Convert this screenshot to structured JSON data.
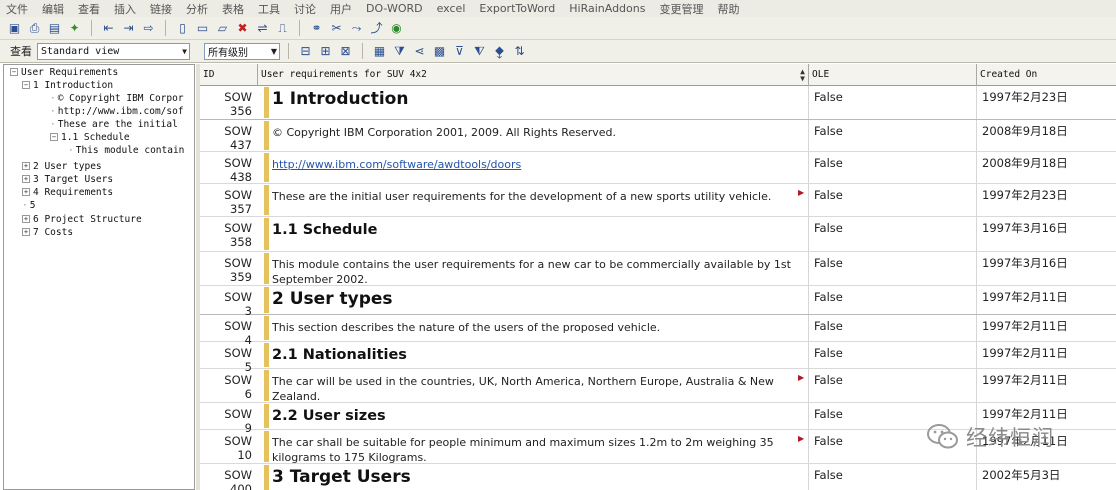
{
  "menu": [
    "文件",
    "编辑",
    "查看",
    "插入",
    "链接",
    "分析",
    "表格",
    "工具",
    "讨论",
    "用户",
    "DO-WORD",
    "excel",
    "ExportToWord",
    "HiRainAddons",
    "变更管理",
    "帮助"
  ],
  "toolbar": {
    "view_label": "查看",
    "view_value": "Standard view",
    "level_value": "所有级别"
  },
  "tree": [
    {
      "label": "User Requirements",
      "indent": 0,
      "expander": "−"
    },
    {
      "label": "1 Introduction",
      "indent": 1,
      "expander": "−"
    },
    {
      "label": "© Copyright IBM Corpor",
      "indent": 2,
      "expander": ""
    },
    {
      "label": "http://www.ibm.com/sof",
      "indent": 2,
      "expander": ""
    },
    {
      "label": "These are the initial",
      "indent": 2,
      "expander": ""
    },
    {
      "label": "1.1 Schedule",
      "indent": 2,
      "expander": "−"
    },
    {
      "label": "This module contain",
      "indent": 3,
      "expander": ""
    },
    {
      "label": "2 User types",
      "indent": 1,
      "expander": "+"
    },
    {
      "label": "3 Target Users",
      "indent": 1,
      "expander": "+"
    },
    {
      "label": "4 Requirements",
      "indent": 1,
      "expander": "+"
    },
    {
      "label": "5",
      "indent": 1,
      "expander": ""
    },
    {
      "label": "6 Project Structure",
      "indent": 1,
      "expander": "+"
    },
    {
      "label": "7 Costs",
      "indent": 1,
      "expander": "+"
    }
  ],
  "grid": {
    "columns": {
      "id": "ID",
      "title": "User requirements for SUV 4x2",
      "ole": "OLE",
      "created": "Created On"
    },
    "rows": [
      {
        "id": "SOW 356",
        "text": "1 Introduction",
        "style": "h1",
        "ole": "False",
        "date": "1997年2月23日"
      },
      {
        "id": "SOW 437",
        "text": "© Copyright IBM Corporation 2001, 2009. All Rights Reserved.",
        "style": "",
        "ole": "False",
        "date": "2008年9月18日"
      },
      {
        "id": "SOW 438",
        "text": "http://www.ibm.com/software/awdtools/doors",
        "style": "link",
        "ole": "False",
        "date": "2008年9月18日"
      },
      {
        "id": "SOW 357",
        "text": "These are the initial user requirements for the development of a new sports utility vehicle.",
        "style": "",
        "ole": "False",
        "date": "1997年2月23日",
        "flag": true
      },
      {
        "id": "SOW 358",
        "text": "1.1 Schedule",
        "style": "h2",
        "ole": "False",
        "date": "1997年3月16日"
      },
      {
        "id": "SOW 359",
        "text": "This module contains the user requirements for a new car to be commercially available by 1st September 2002.",
        "style": "",
        "ole": "False",
        "date": "1997年3月16日"
      },
      {
        "id": "SOW 3",
        "text": "2 User types",
        "style": "h1",
        "ole": "False",
        "date": "1997年2月11日"
      },
      {
        "id": "SOW 4",
        "text": "This section describes the nature of the users of the proposed vehicle.",
        "style": "",
        "ole": "False",
        "date": "1997年2月11日"
      },
      {
        "id": "SOW 5",
        "text": "2.1 Nationalities",
        "style": "h2",
        "ole": "False",
        "date": "1997年2月11日"
      },
      {
        "id": "SOW 6",
        "text": "The car will be used in the countries, UK, North America, Northern Europe, Australia & New Zealand.",
        "style": "",
        "ole": "False",
        "date": "1997年2月11日",
        "flag": true
      },
      {
        "id": "SOW 9",
        "text": "2.2 User sizes",
        "style": "h2",
        "ole": "False",
        "date": "1997年2月11日"
      },
      {
        "id": "SOW 10",
        "text": "The car shall be suitable for people minimum and maximum sizes 1.2m to 2m weighing 35 kilograms to 175 Kilograms.",
        "style": "",
        "ole": "False",
        "date": "1997年2月11日",
        "flag": true
      },
      {
        "id": "SOW 400",
        "text": "3 Target Users",
        "style": "h1",
        "ole": "False",
        "date": "2002年5月3日"
      }
    ]
  },
  "watermark": {
    "text": "经纬恒润",
    "icon": "wechat-icon"
  },
  "colors": {
    "heading_bar": "#e6c25c",
    "link": "#2255aa",
    "flag": "#b01828"
  }
}
